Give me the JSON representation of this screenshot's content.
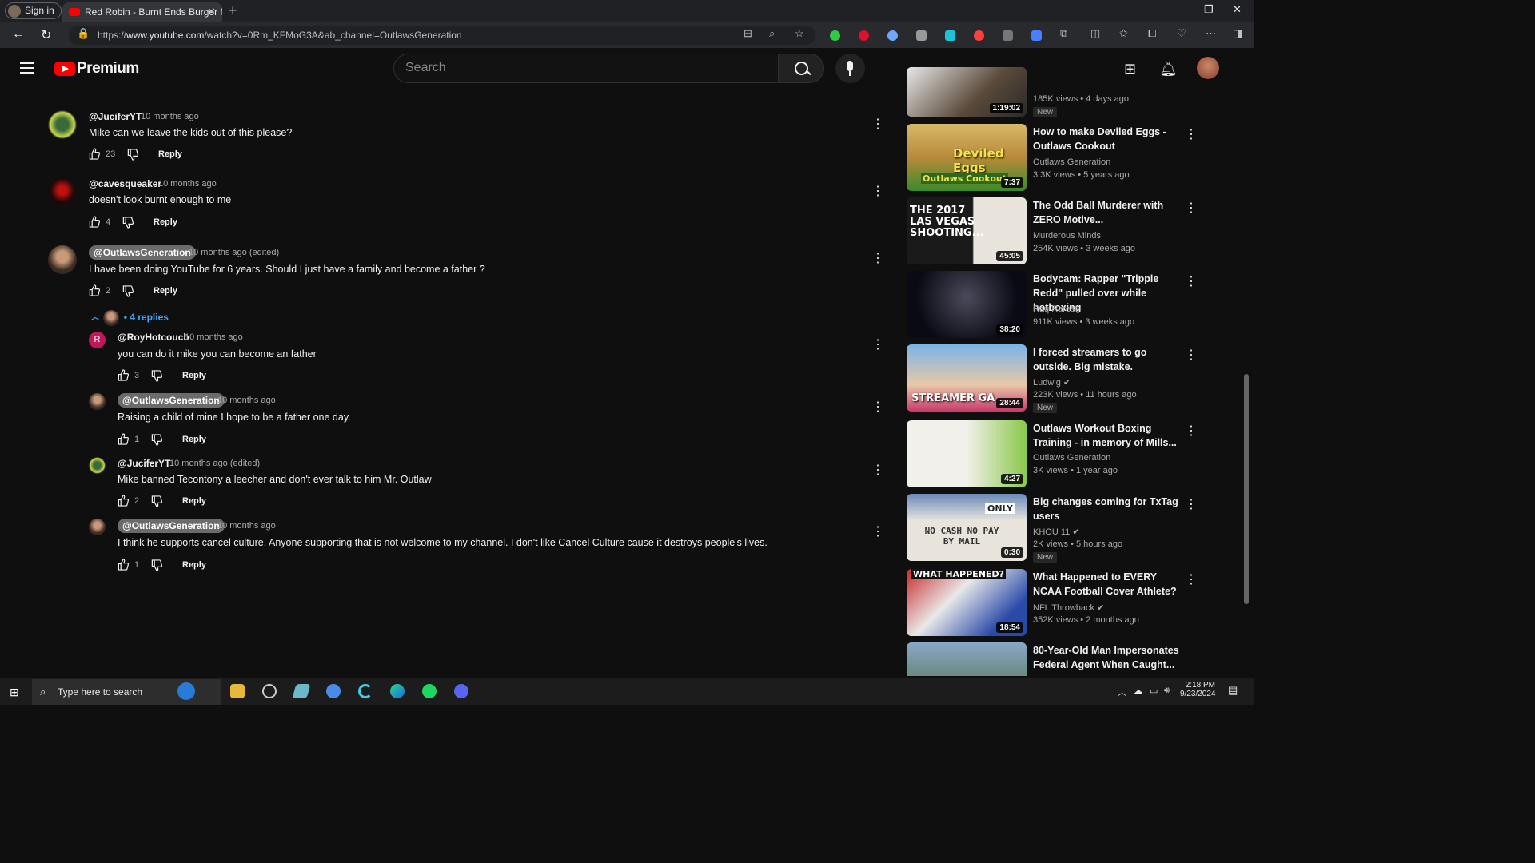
{
  "browser": {
    "signin_label": "Sign in",
    "tab_title": "Red Robin - Burnt Ends Burger fo",
    "url_prefix": "https://",
    "url_host": "www.youtube.com",
    "url_path": "/watch?v=0Rm_KFMoG3A&ab_channel=OutlawsGeneration"
  },
  "header": {
    "brand": "Premium",
    "search_placeholder": "Search"
  },
  "comments": [
    {
      "author": "@JuciferYT",
      "time": "10 months ago",
      "text": "Mike can we leave the kids out of this please?",
      "likes": "23",
      "reply_label": "Reply"
    },
    {
      "author": "@cavesqueaker",
      "time": "10 months ago",
      "text": "doesn't look burnt enough to me",
      "likes": "4",
      "reply_label": "Reply"
    },
    {
      "author": "@OutlawsGeneration",
      "time": "10 months ago (edited)",
      "text": "I have been doing YouTube for 6 years. Should I just have a family and become a father ?",
      "likes": "2",
      "reply_label": "Reply"
    }
  ],
  "replies_toggle": "4 replies",
  "replies": [
    {
      "author": "@RoyHotcouch",
      "avatar_letter": "R",
      "time": "10 months ago",
      "text": "you can do it mike you can become an father",
      "likes": "3",
      "reply_label": "Reply"
    },
    {
      "author": "@OutlawsGeneration",
      "time": "10 months ago",
      "text": "Raising a child of mine I hope to be a father one day.",
      "likes": "1",
      "reply_label": "Reply"
    },
    {
      "author": "@JuciferYT",
      "time": "10 months ago (edited)",
      "text": "Mike banned Tecontony a leecher and don't ever talk to him Mr. Outlaw",
      "likes": "2",
      "reply_label": "Reply"
    },
    {
      "author": "@OutlawsGeneration",
      "time": "10 months ago",
      "text": "I think he supports cancel culture. Anyone supporting that is not welcome to my channel. I don't like Cancel Culture cause it destroys people's lives.",
      "likes": "1",
      "reply_label": "Reply"
    }
  ],
  "sidebar": [
    {
      "duration": "1:19:02",
      "meta": "185K views • 4 days ago",
      "badge": "New"
    },
    {
      "title": "How to make Deviled Eggs - Outlaws Cookout",
      "channel": "Outlaws Generation",
      "meta": "3.3K views • 5 years ago",
      "duration": "7:37",
      "thumb_text": "Deviled Eggs",
      "thumb_sub": "Outlaws Cookout"
    },
    {
      "title": "The Odd Ball Murderer with ZERO Motive...",
      "channel": "Murderous Minds",
      "meta": "254K views • 3 weeks ago",
      "duration": "45:05",
      "thumb_text": "THE 2017 LAS VEGAS SHOOTING..."
    },
    {
      "title": "Bodycam: Rapper \"Trippie Redd\" pulled over while hotboxing",
      "channel": "Raq Rarest",
      "meta": "911K views • 3 weeks ago",
      "duration": "38:20"
    },
    {
      "title": "I forced streamers to go outside. Big mistake.",
      "channel": "Ludwig",
      "meta": "223K views • 11 hours ago",
      "badge": "New",
      "duration": "28:44",
      "thumb_text": "STREAMER GA"
    },
    {
      "title": "Outlaws Workout Boxing Training - in memory of Mills...",
      "channel": "Outlaws Generation",
      "meta": "3K views • 1 year ago",
      "duration": "4:27"
    },
    {
      "title": "Big changes coming for TxTag users",
      "channel": "KHOU 11",
      "meta": "2K views • 5 hours ago",
      "badge": "New",
      "duration": "0:30",
      "thumb_text": "NO CASH NO PAY BY MAIL",
      "thumb_sub": "ONLY"
    },
    {
      "title": "What Happened to EVERY NCAA Football Cover Athlete?",
      "channel": "NFL Throwback",
      "meta": "352K views • 2 months ago",
      "duration": "18:54",
      "thumb_text": "WHAT HAPPENED?"
    },
    {
      "title": "80-Year-Old Man Impersonates Federal Agent When Caught..."
    }
  ],
  "taskbar": {
    "search_placeholder": "Type here to search",
    "time": "2:18 PM",
    "date": "9/23/2024"
  },
  "colors": {
    "accent": "#3ea6ff",
    "brand_red": "#ff0000",
    "pill_bg": "#6b6b6b"
  }
}
